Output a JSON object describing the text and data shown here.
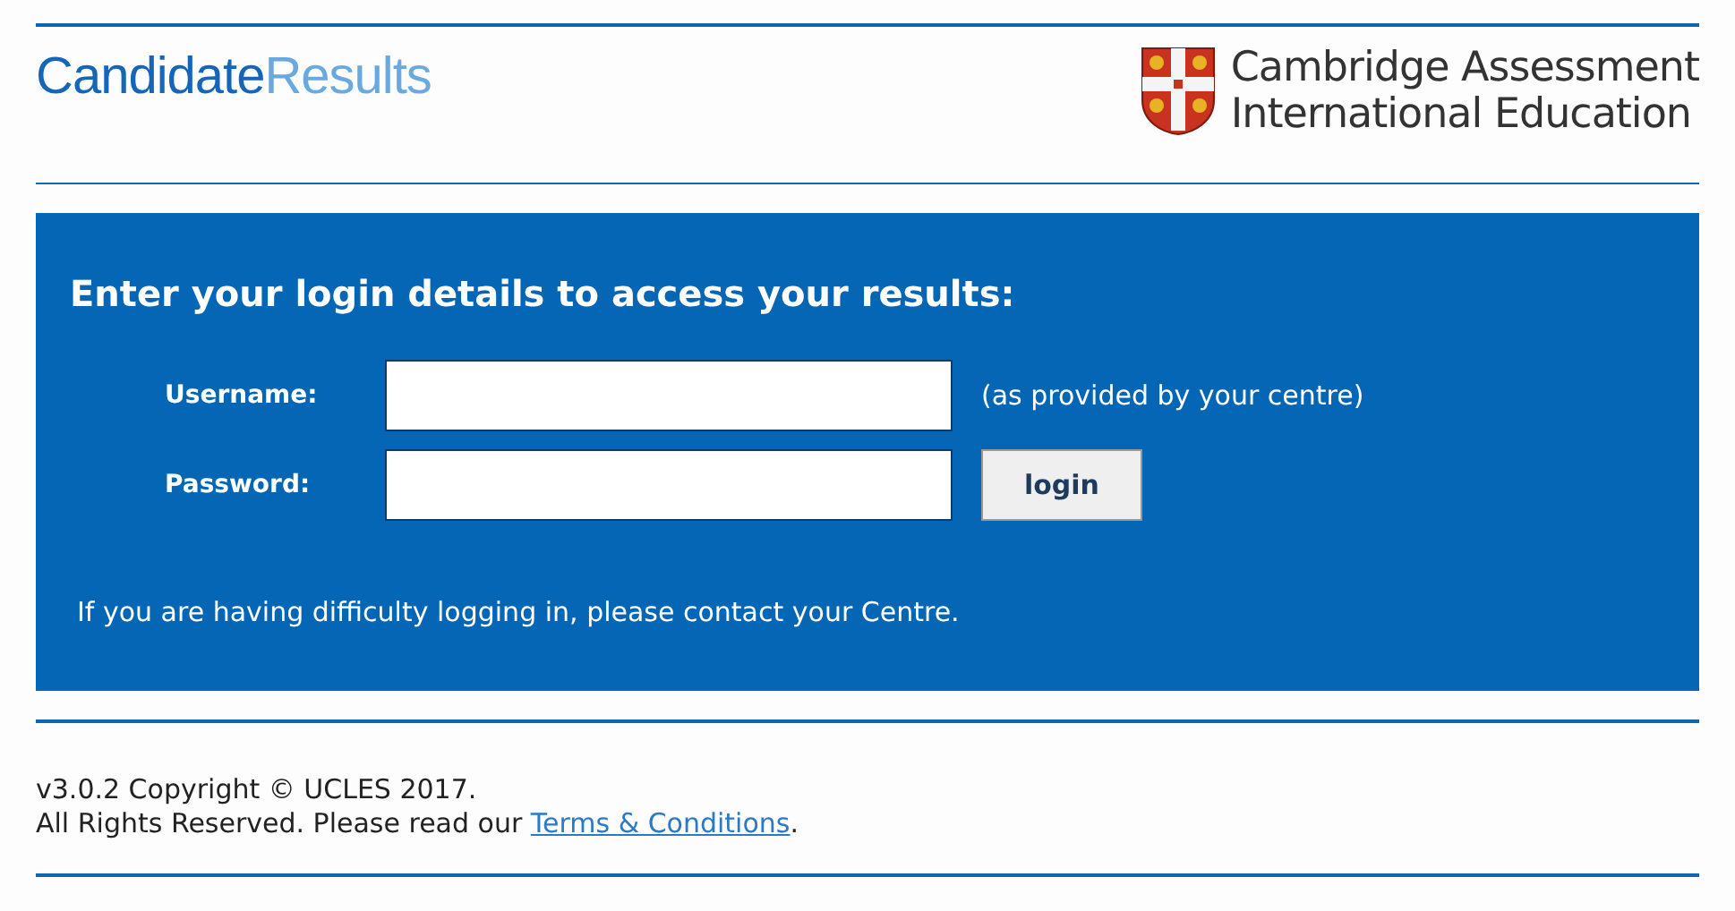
{
  "header": {
    "brand": {
      "primary": "Candidate",
      "secondary": "Results"
    },
    "organisation": [
      "Cambridge Assessment",
      "International Education"
    ]
  },
  "login_panel": {
    "title": "Enter your login details to access your results:",
    "fields": [
      {
        "label": "Username:",
        "hint": "(as provided by your centre)"
      },
      {
        "label": "Password:",
        "button": "login"
      }
    ],
    "help": "If you are having difficulty logging in, please contact your Centre."
  },
  "footer": {
    "copyright": "v3.0.2 Copyright © UCLES 2017.",
    "rights": "All Rights Reserved. Please read our",
    "link": "Terms & Conditions",
    "end": "."
  }
}
